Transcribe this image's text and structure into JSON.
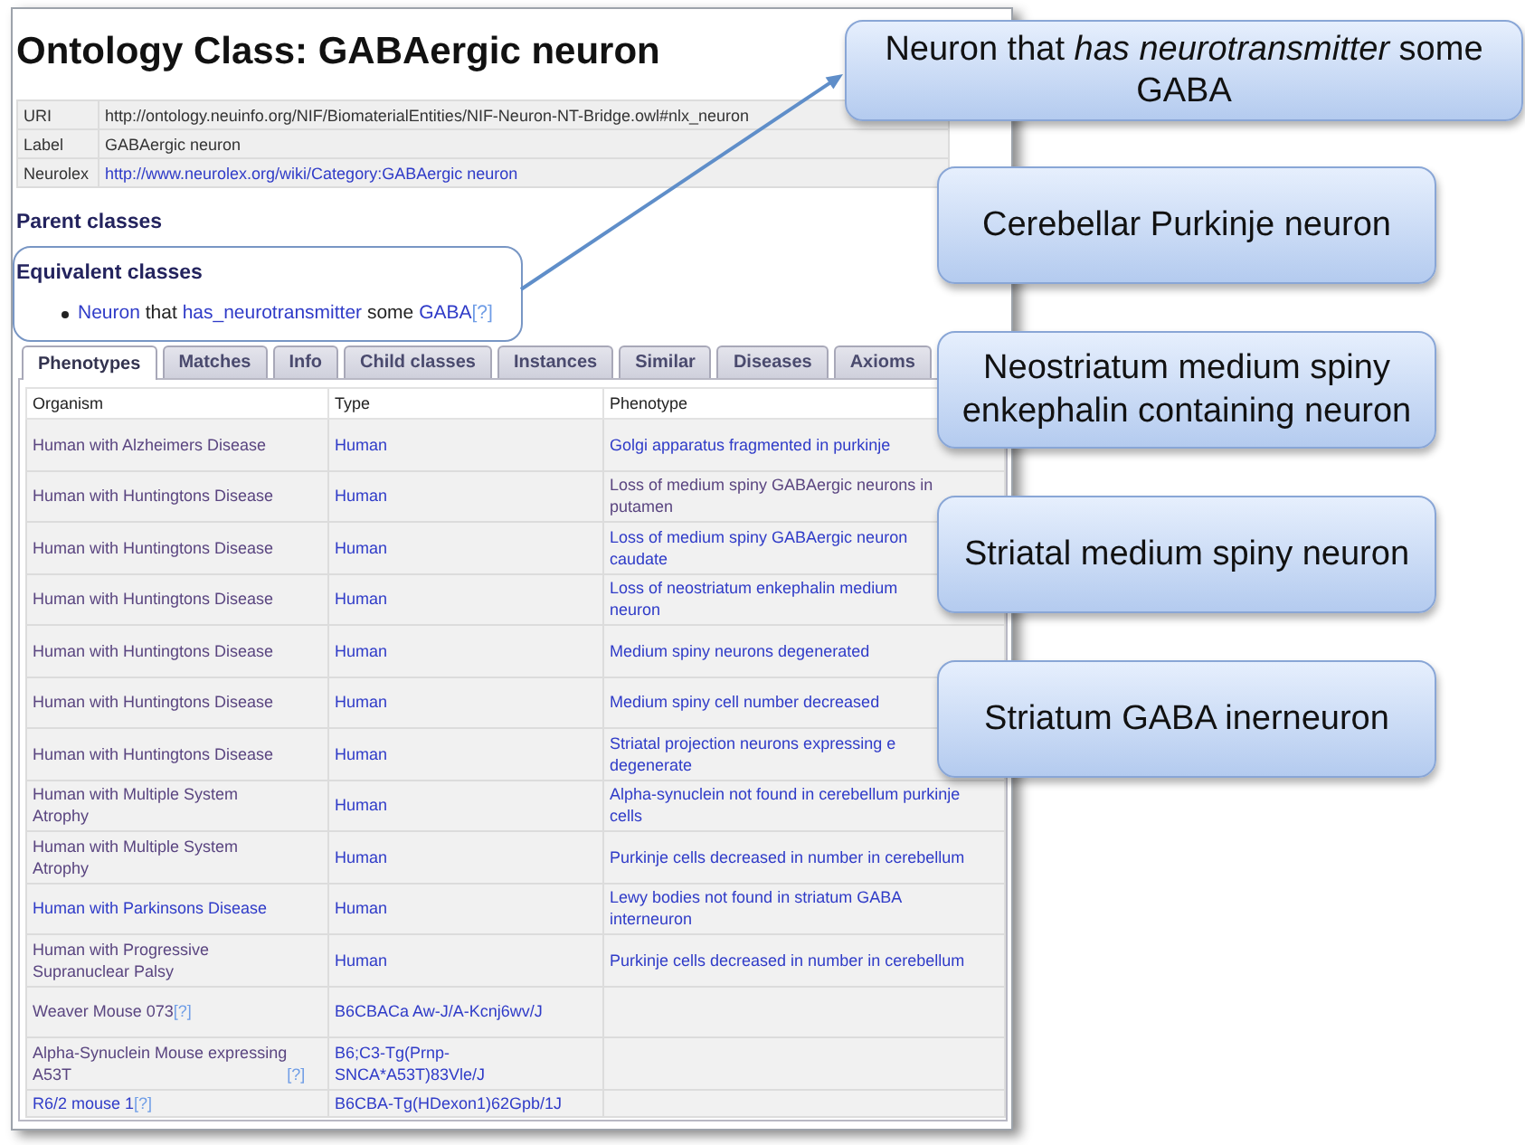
{
  "page": {
    "title": "Ontology Class: GABAergic neuron"
  },
  "properties": [
    {
      "label": "URI",
      "value": "http://ontology.neuinfo.org/NIF/BiomaterialEntities/NIF-Neuron-NT-Bridge.owl#nlx_neuron",
      "kind": "text"
    },
    {
      "label": "Label",
      "value": "GABAergic neuron",
      "kind": "text"
    },
    {
      "label": "Neurolex",
      "value": "http://www.neurolex.org/wiki/Category:GABAergic neuron",
      "kind": "link"
    }
  ],
  "parent_classes": {
    "heading": "Parent classes"
  },
  "equivalent_classes": {
    "heading": "Equivalent classes",
    "items": [
      {
        "parts": [
          {
            "text": "Neuron",
            "kind": "link"
          },
          {
            "text": "that",
            "kind": "plain"
          },
          {
            "text": "has_neurotransmitter",
            "kind": "link"
          },
          {
            "text": "some",
            "kind": "plain"
          },
          {
            "text": "GABA",
            "kind": "link"
          },
          {
            "text": "[?]",
            "kind": "help"
          }
        ]
      }
    ]
  },
  "tabs": [
    {
      "label": "Phenotypes",
      "selected": true
    },
    {
      "label": "Matches",
      "selected": false
    },
    {
      "label": "Info",
      "selected": false
    },
    {
      "label": "Child classes",
      "selected": false
    },
    {
      "label": "Instances",
      "selected": false
    },
    {
      "label": "Similar",
      "selected": false
    },
    {
      "label": "Diseases",
      "selected": false
    },
    {
      "label": "Axioms",
      "selected": false
    }
  ],
  "phenotype_table": {
    "columns": [
      "Organism",
      "Type",
      "Phenotype"
    ],
    "rows": [
      {
        "organism": {
          "text": "Human with Alzheimers Disease",
          "visited": true
        },
        "type": "Human",
        "phenotype": {
          "text": "Golgi apparatus fragmented in purkinje",
          "visited": false
        }
      },
      {
        "organism": {
          "text": "Human with Huntingtons Disease",
          "visited": true
        },
        "type": "Human",
        "phenotype": {
          "text": "Loss of medium spiny GABAergic neurons in\nputamen",
          "visited": true
        }
      },
      {
        "organism": {
          "text": "Human with Huntingtons Disease",
          "visited": true
        },
        "type": "Human",
        "phenotype": {
          "text": "Loss of medium spiny GABAergic neuron\ncaudate",
          "visited": false
        }
      },
      {
        "organism": {
          "text": "Human with Huntingtons Disease",
          "visited": true
        },
        "type": "Human",
        "phenotype": {
          "text": "Loss of neostriatum enkephalin medium\nneuron",
          "visited": false
        }
      },
      {
        "organism": {
          "text": "Human with Huntingtons Disease",
          "visited": true
        },
        "type": "Human",
        "phenotype": {
          "text": "Medium spiny neurons degenerated",
          "visited": false
        }
      },
      {
        "organism": {
          "text": "Human with Huntingtons Disease",
          "visited": true
        },
        "type": "Human",
        "phenotype": {
          "text": "Medium spiny cell number decreased",
          "visited": false
        }
      },
      {
        "organism": {
          "text": "Human with Huntingtons Disease",
          "visited": true
        },
        "type": "Human",
        "phenotype": {
          "text": "Striatal projection neurons expressing e\ndegenerate",
          "visited": false
        }
      },
      {
        "organism": {
          "text": "Human with Multiple System\nAtrophy",
          "visited": true
        },
        "type": "Human",
        "phenotype": {
          "text": "Alpha-synuclein not found in cerebellum purkinje\ncells",
          "visited": false
        }
      },
      {
        "organism": {
          "text": "Human with Multiple System\nAtrophy",
          "visited": true
        },
        "type": "Human",
        "phenotype": {
          "text": "Purkinje cells decreased in number in cerebellum",
          "visited": false
        }
      },
      {
        "organism": {
          "text": "Human with Parkinsons Disease",
          "visited": false
        },
        "type": "Human",
        "phenotype": {
          "text": "Lewy bodies not found in striatum GABA\ninterneuron",
          "visited": false
        }
      },
      {
        "organism": {
          "text": "Human with Progressive\nSupranuclear Palsy",
          "visited": true
        },
        "type": "Human",
        "phenotype": {
          "text": "Purkinje cells decreased in number in cerebellum",
          "visited": false
        }
      },
      {
        "organism": {
          "text": "Weaver Mouse 073",
          "visited": true,
          "help": "[?]"
        },
        "type": "B6CBACa Aw-J/A-Kcnj6wv/J"
      },
      {
        "organism": {
          "text": "Alpha-Synuclein Mouse expressing\nA53T",
          "visited": true,
          "help": "[?]"
        },
        "type": "B6;C3-Tg(Prnp-\nSNCA*A53T)83Vle/J"
      },
      {
        "organism": {
          "text": "R6/2 mouse 1",
          "visited": false,
          "help": "[?]"
        },
        "type": "B6CBA-Tg(HDexon1)62Gpb/1J"
      }
    ]
  },
  "callouts": [
    {
      "text": "Neuron that *has neurotransmitter* some GABA"
    },
    {
      "text": "Cerebellar Purkinje neuron"
    },
    {
      "text": "Neostriatum medium spiny enkephalin containing neuron"
    },
    {
      "text": "Striatal medium spiny neuron"
    },
    {
      "text": "Striatum GABA inerneuron"
    }
  ]
}
